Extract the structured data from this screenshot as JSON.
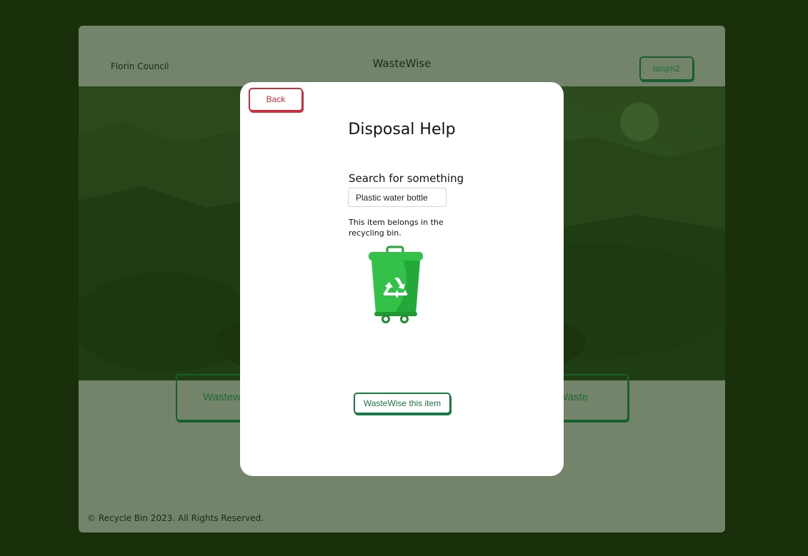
{
  "header": {
    "council_name": "Florin Council",
    "brand_title": "WasteWise",
    "user_button_label": "laisjm2"
  },
  "cards": {
    "left_label": "Wastew",
    "right_label": "cy Waste"
  },
  "footer": {
    "copyright": "© Recycle Bin 2023. All Rights Reserved."
  },
  "modal": {
    "back_label": "Back",
    "title": "Disposal Help",
    "search_label": "Search for something",
    "search_value": "Plastic water bottle",
    "result_text": "This item belongs in the recycling bin.",
    "bin_icon": "recycling-bin-icon",
    "action_label": "WasteWise this item"
  },
  "colors": {
    "overlay_bg": "#1a300a",
    "app_bg": "#73846a",
    "brand_green": "#175f2e",
    "back_red": "#c9303f",
    "bin_green": "#33c14a"
  }
}
